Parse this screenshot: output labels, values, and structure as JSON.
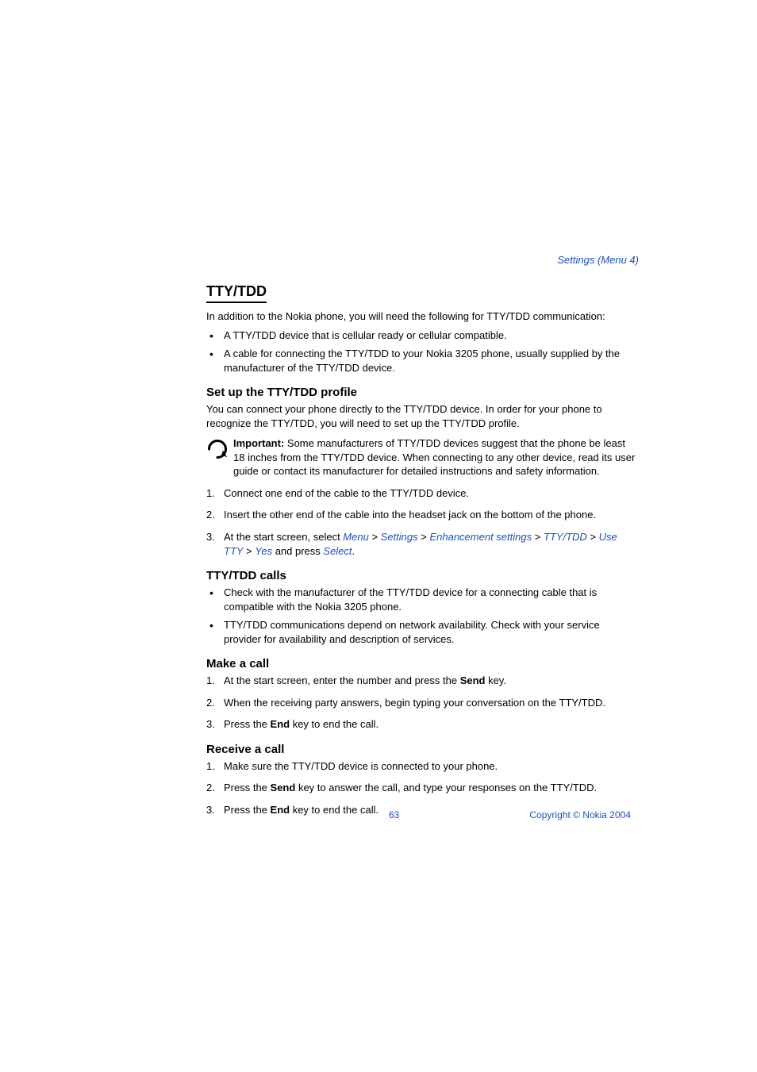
{
  "header_link": "Settings (Menu 4)",
  "h1": "TTY/TDD",
  "intro": "In addition to the Nokia phone, you will need the following for TTY/TDD communication:",
  "intro_bullets": [
    "A TTY/TDD device that is cellular ready or cellular compatible.",
    "A cable for connecting the TTY/TDD to your Nokia 3205 phone, usually supplied by the manufacturer of the TTY/TDD device."
  ],
  "setup": {
    "heading": "Set up the TTY/TDD profile",
    "para": "You can connect your phone directly to the TTY/TDD device. In order for your phone to recognize the TTY/TDD, you will need to set up the TTY/TDD profile.",
    "note_label": "Important:",
    "note_body": " Some manufacturers of TTY/TDD devices suggest that the phone be least 18 inches from the TTY/TDD device. When connecting to any other device, read its user guide or contact its manufacturer for detailed instructions and safety information.",
    "steps_pre": [
      "Connect one end of the cable to the TTY/TDD device.",
      "Insert the other end of the cable into the headset jack on the bottom of the phone."
    ],
    "step3_lead": "At the start screen, select ",
    "nav": {
      "menu": "Menu",
      "settings": "Settings",
      "enh": "Enhancement settings",
      "tty": "TTY/TDD",
      "use_tty": "Use TTY",
      "yes": "Yes",
      "select": "Select"
    },
    "gt": " > ",
    "step3_mid": " and press ",
    "step3_end": "."
  },
  "calls": {
    "heading": "TTY/TDD calls",
    "bullets": [
      "Check with the manufacturer of the TTY/TDD device for a connecting cable that is compatible with the Nokia 3205 phone.",
      "TTY/TDD communications depend on network availability. Check with your service provider for availability and description of services."
    ]
  },
  "make": {
    "heading": "Make a call",
    "s1a": "At the start screen, enter the number and press the ",
    "s1b": "Send",
    "s1c": " key.",
    "s2": "When the receiving party answers, begin typing your conversation on the TTY/TDD.",
    "s3a": "Press the ",
    "s3b": "End",
    "s3c": " key to end the call."
  },
  "receive": {
    "heading": "Receive a call",
    "s1": "Make sure the TTY/TDD device is connected to your phone.",
    "s2a": "Press the ",
    "s2b": "Send",
    "s2c": " key to answer the call, and type your responses on the TTY/TDD.",
    "s3a": "Press the ",
    "s3b": "End",
    "s3c": " key to end the call."
  },
  "footer": {
    "page": "63",
    "copyright": "Copyright © Nokia 2004"
  }
}
